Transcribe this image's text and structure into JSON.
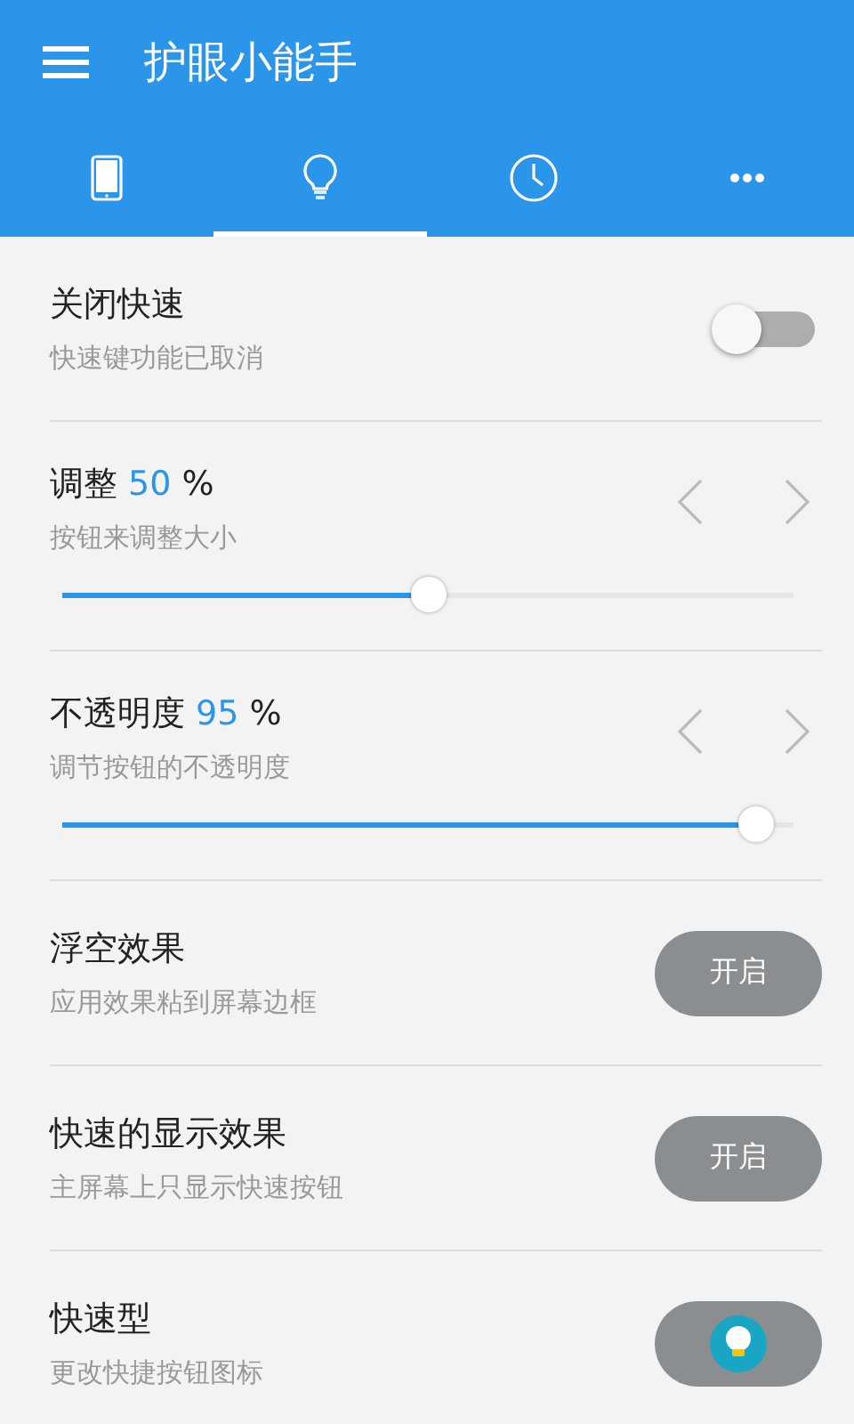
{
  "app_bar": {
    "title": "护眼小能手"
  },
  "tabs": [
    {
      "selected": false
    },
    {
      "selected": true
    },
    {
      "selected": false
    },
    {
      "selected": false
    }
  ],
  "settings": [
    {
      "kind": "toggle",
      "title": "关闭快速",
      "subtitle": "快速键功能已取消",
      "on": false
    },
    {
      "kind": "slider",
      "title": "调整",
      "value": "50",
      "unit": "%",
      "subtitle": "按钮来调整大小",
      "level": 0.5
    },
    {
      "kind": "slider",
      "title": "不透明度",
      "value": "95",
      "unit": "%",
      "subtitle": "调节按钮的不透明度",
      "level": 0.95
    },
    {
      "kind": "button",
      "title": "浮空效果",
      "subtitle": "应用效果粘到屏幕边框",
      "button": "开启"
    },
    {
      "kind": "button",
      "title": "快速的显示效果",
      "subtitle": "主屏幕上只显示快速按钮",
      "button": "开启"
    },
    {
      "kind": "icon_button",
      "title": "快速型",
      "subtitle": "更改快捷按钮图标"
    }
  ]
}
